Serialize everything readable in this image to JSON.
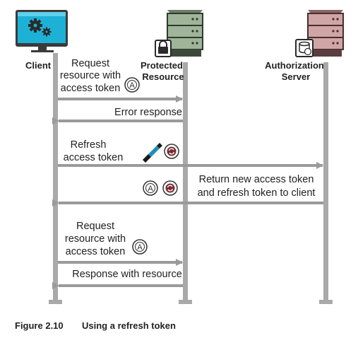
{
  "participants": {
    "client": "Client",
    "protected_line1": "Protected",
    "protected_line2": "Resource",
    "auth_line1": "Authorization",
    "auth_line2": "Server"
  },
  "messages": {
    "m1_line1": "Request",
    "m1_line2": "resource with",
    "m1_line3": "access token",
    "m2": "Error response",
    "m3_line1": "Refresh",
    "m3_line2": "access token",
    "m4_line1": "Return new access token",
    "m4_line2": "and refresh token to client",
    "m5_line1": "Request",
    "m5_line2": "resource with",
    "m5_line3": "access token",
    "m6": "Response with resource"
  },
  "badges": {
    "access_letter": "A"
  },
  "caption": {
    "number": "Figure 2.10",
    "title": "Using a refresh token"
  },
  "colors": {
    "lifeline": "#a9a9a9",
    "arrow": "#9a9a9a",
    "server_green": "#9fb59a",
    "server_pink": "#cfa5a5",
    "monitor": "#1db1d6"
  }
}
